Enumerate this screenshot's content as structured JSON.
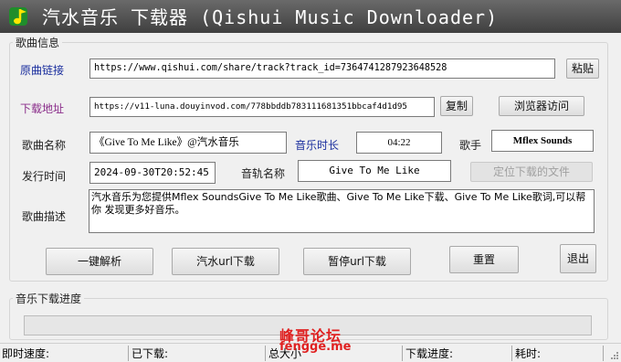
{
  "window": {
    "title": "汽水音乐 下载器 (Qishui Music Downloader)",
    "logo_icon": "music-note-icon"
  },
  "song_info": {
    "group_title": "歌曲信息",
    "source_link": {
      "label": "原曲链接",
      "value": "https://www.qishui.com/share/track?track_id=7364741287923648528",
      "paste_button": "粘贴"
    },
    "download_url": {
      "label": "下载地址",
      "value": "https://v11-luna.douyinvod.com/778bbddb783111681351bbcaf4d1d95",
      "copy_button": "复制",
      "browser_button": "浏览器访问"
    },
    "song_name": {
      "label": "歌曲名称",
      "value": "《Give To Me Like》@汽水音乐"
    },
    "duration": {
      "label": "音乐时长",
      "value": "04:22"
    },
    "singer": {
      "label": "歌手",
      "value": "Mflex Sounds"
    },
    "release_time": {
      "label": "发行时间",
      "value": "2024-09-30T20:52:45"
    },
    "track_name": {
      "label": "音轨名称",
      "value": "Give To Me Like"
    },
    "locate_button": "定位下载的文件",
    "description": {
      "label": "歌曲描述",
      "value": "汽水音乐为您提供Mflex SoundsGive To Me Like歌曲、Give To Me Like下载、Give To Me Like歌词,可以帮你 发现更多好音乐。"
    },
    "actions": {
      "parse": "一键解析",
      "qishui_url_download": "汽水url下载",
      "pause_url_download": "暂停url下载",
      "reset": "重置",
      "exit": "退出"
    }
  },
  "download_progress": {
    "group_title": "音乐下载进度",
    "progress": 0
  },
  "statusbar": {
    "speed": "即时速度:",
    "downloaded": "已下载:",
    "total_size": "总大小",
    "download_progress": "下载进度:",
    "elapsed": "耗时:"
  },
  "watermark": {
    "text_cn": "峰哥论坛",
    "text_en": "fengge.me"
  },
  "colors": {
    "title_bar": "#4a4a4a",
    "label_blue": "#1b2f9e",
    "label_purple": "#8a2d8a",
    "watermark": "#e02020",
    "logo": "#2fc43a"
  }
}
